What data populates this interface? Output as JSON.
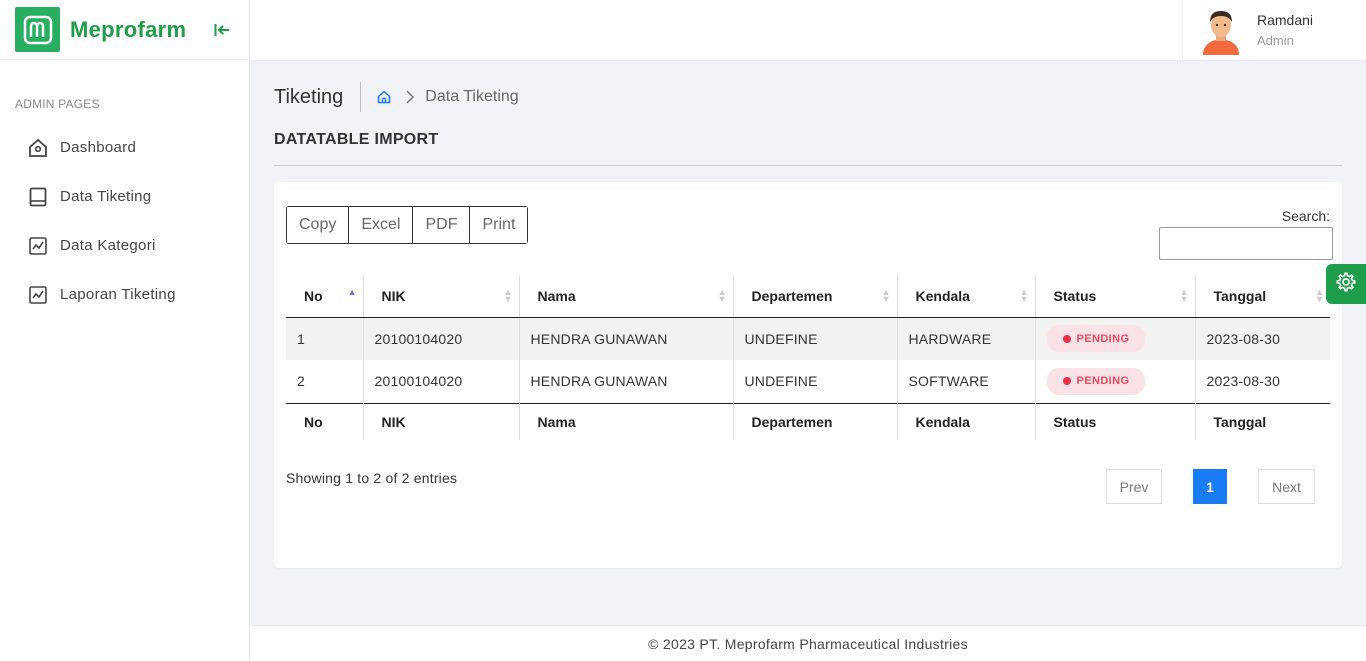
{
  "brand": {
    "name": "Meprofarm",
    "color": "#1e9e4a"
  },
  "sidebar": {
    "section": "ADMIN PAGES",
    "items": [
      {
        "label": "Dashboard",
        "icon": "home-icon"
      },
      {
        "label": "Data Tiketing",
        "icon": "book-icon"
      },
      {
        "label": "Data Kategori",
        "icon": "chart-line-icon"
      },
      {
        "label": "Laporan Tiketing",
        "icon": "chart-line-icon"
      }
    ]
  },
  "user": {
    "name": "Ramdani",
    "role": "Admin"
  },
  "header": {
    "title": "Tiketing",
    "breadcrumb_current": "Data Tiketing"
  },
  "section_title": "DATATABLE IMPORT",
  "toolbar": {
    "copy": "Copy",
    "excel": "Excel",
    "pdf": "PDF",
    "print": "Print"
  },
  "search": {
    "label": "Search:",
    "value": ""
  },
  "table": {
    "columns": [
      "No",
      "NIK",
      "Nama",
      "Departemen",
      "Kendala",
      "Status",
      "Tanggal"
    ],
    "rows": [
      {
        "no": "1",
        "nik": "20100104020",
        "nama": "HENDRA GUNAWAN",
        "departemen": "UNDEFINE",
        "kendala": "HARDWARE",
        "status": "PENDING",
        "tanggal": "2023-08-30"
      },
      {
        "no": "2",
        "nik": "20100104020",
        "nama": "HENDRA GUNAWAN",
        "departemen": "UNDEFINE",
        "kendala": "SOFTWARE",
        "status": "PENDING",
        "tanggal": "2023-08-30"
      }
    ]
  },
  "pagination": {
    "info": "Showing 1 to 2 of 2 entries",
    "prev": "Prev",
    "current": "1",
    "next": "Next",
    "active_color": "#1a7cf5"
  },
  "footer": {
    "text": "© 2023 PT. Meprofarm Pharmaceutical Industries"
  }
}
